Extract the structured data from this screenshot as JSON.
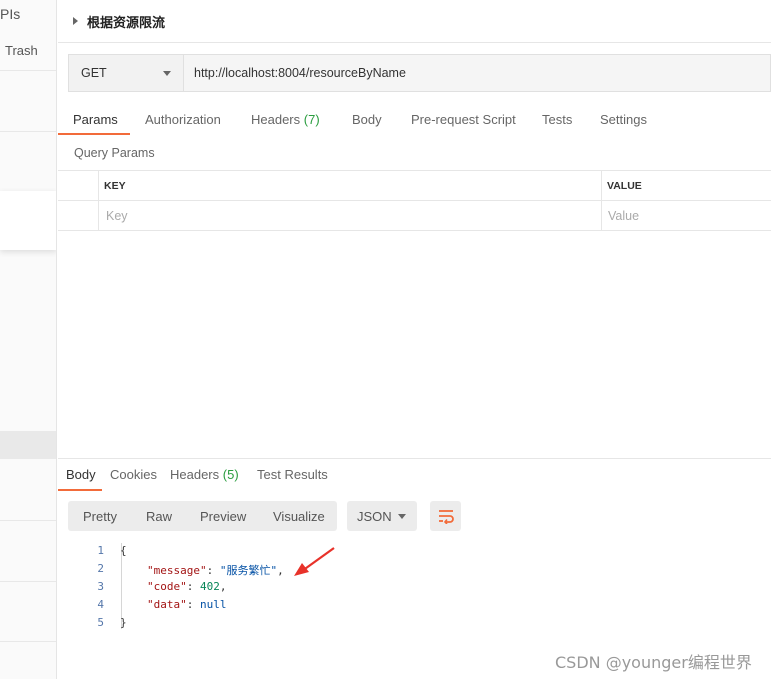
{
  "sidebar": {
    "apis_label": "PIs",
    "trash_label": "Trash"
  },
  "request": {
    "title": "根据资源限流",
    "method": "GET",
    "url": "http://localhost:8004/resourceByName"
  },
  "request_tabs": [
    {
      "label": "Params"
    },
    {
      "label": "Authorization"
    },
    {
      "label": "Headers",
      "count": "(7)"
    },
    {
      "label": "Body"
    },
    {
      "label": "Pre-request Script"
    },
    {
      "label": "Tests"
    },
    {
      "label": "Settings"
    }
  ],
  "params": {
    "section_title": "Query Params",
    "columns": [
      "KEY",
      "VALUE"
    ],
    "key_placeholder": "Key",
    "value_placeholder": "Value"
  },
  "response_tabs": [
    {
      "label": "Body"
    },
    {
      "label": "Cookies"
    },
    {
      "label": "Headers",
      "count": "(5)"
    },
    {
      "label": "Test Results"
    }
  ],
  "response_view": {
    "modes": [
      "Pretty",
      "Raw",
      "Preview",
      "Visualize"
    ],
    "format": "JSON"
  },
  "response_body": {
    "line_numbers": [
      "1",
      "2",
      "3",
      "4",
      "5"
    ],
    "open_brace": "{",
    "close_brace": "}",
    "fields": [
      {
        "key": "\"message\"",
        "value": "\"服务繁忙\""
      },
      {
        "key": "\"code\"",
        "value": "402"
      },
      {
        "key": "\"data\"",
        "value": "null"
      }
    ]
  },
  "colors": {
    "accent": "#f26b3a",
    "count_green": "#2a9d3f",
    "annotation_arrow": "#e8322a"
  },
  "watermark": "CSDN @younger编程世界"
}
